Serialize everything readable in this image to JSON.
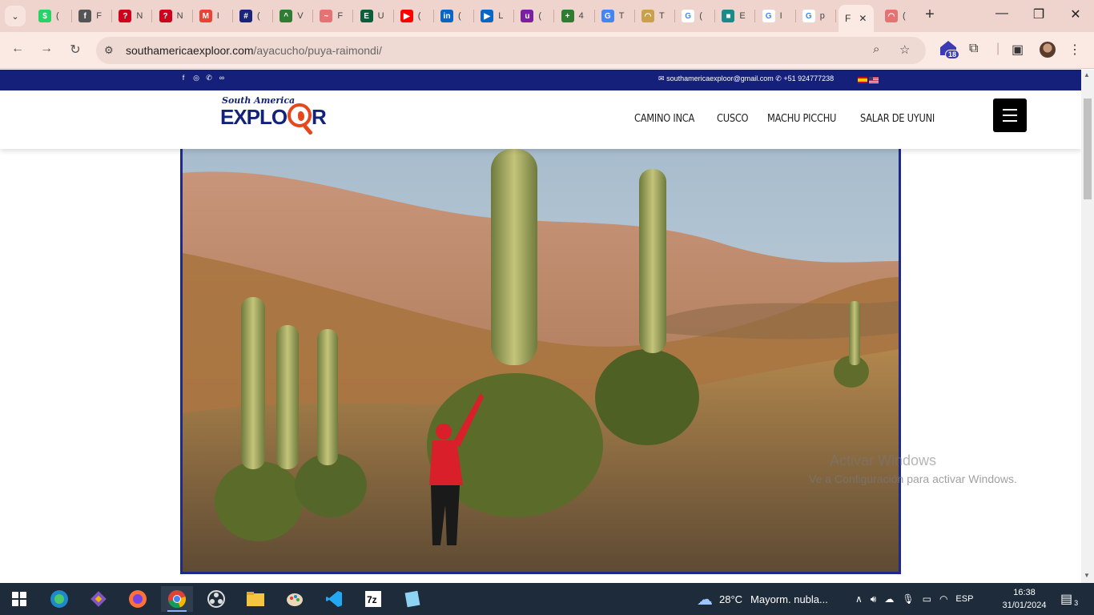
{
  "browser": {
    "tabs": [
      {
        "letter": "(",
        "color": "#25d366",
        "glyph": "$"
      },
      {
        "letter": "F",
        "color": "#555555",
        "glyph": "f"
      },
      {
        "letter": "N",
        "color": "#d0021b",
        "glyph": "?"
      },
      {
        "letter": "N",
        "color": "#d0021b",
        "glyph": "?"
      },
      {
        "letter": "I",
        "color": "#ea4335",
        "glyph": "M"
      },
      {
        "letter": "(",
        "color": "#1a237e",
        "glyph": "#"
      },
      {
        "letter": "V",
        "color": "#2e7d32",
        "glyph": "^"
      },
      {
        "letter": "F",
        "color": "#e57373",
        "glyph": "~"
      },
      {
        "letter": "U",
        "color": "#0b5e3b",
        "glyph": "E"
      },
      {
        "letter": "(",
        "color": "#ff0000",
        "glyph": "▶"
      },
      {
        "letter": "(",
        "color": "#0a66c2",
        "glyph": "in"
      },
      {
        "letter": "L",
        "color": "#0a66c2",
        "glyph": "▶"
      },
      {
        "letter": "(",
        "color": "#7b1fa2",
        "glyph": "u"
      },
      {
        "letter": "4",
        "color": "#2e7d32",
        "glyph": "+"
      },
      {
        "letter": "T",
        "color": "#4285f4",
        "glyph": "G"
      },
      {
        "letter": "T",
        "color": "#c9a14a",
        "glyph": "◠"
      },
      {
        "letter": "(",
        "color": "#ffffff",
        "glyph": "G"
      },
      {
        "letter": "E",
        "color": "#1b8a8a",
        "glyph": "■"
      },
      {
        "letter": "I",
        "color": "#ffffff",
        "glyph": "G"
      },
      {
        "letter": "p",
        "color": "#ffffff",
        "glyph": "G"
      }
    ],
    "active_tab_label": "F",
    "last_tab": {
      "letter": "(",
      "color": "#e57373",
      "glyph": "◠"
    },
    "url_domain": "southamericaexploor.com",
    "url_path": "/ayacucho/puya-raimondi/",
    "extension_badge": "18"
  },
  "site": {
    "contact_email": "southamericaexploor@gmail.com",
    "contact_phone": "+51 924777238",
    "logo_top": "South America",
    "logo_main": "EXPLO",
    "logo_tail": "R",
    "nav": [
      "CAMINO INCA",
      "CUSCO",
      "MACHU PICCHU",
      "SALAR DE UYUNI"
    ],
    "colors": {
      "topbar": "#15207a",
      "accent": "#e8461d"
    }
  },
  "watermark": {
    "line1": "Activar Windows",
    "line2": "Ve a Configuración para activar Windows."
  },
  "taskbar": {
    "weather_temp": "28°C",
    "weather_text": "Mayorm. nubla...",
    "language": "ESP",
    "time": "16:38",
    "date": "31/01/2024",
    "notifications": "3",
    "apps": [
      "start-icon",
      "edge-icon",
      "git-icon",
      "firefox-icon",
      "chrome-icon",
      "obs-icon",
      "file-explorer-icon",
      "paint-icon",
      "vscode-icon",
      "7zip-icon",
      "notepad-icon"
    ]
  }
}
